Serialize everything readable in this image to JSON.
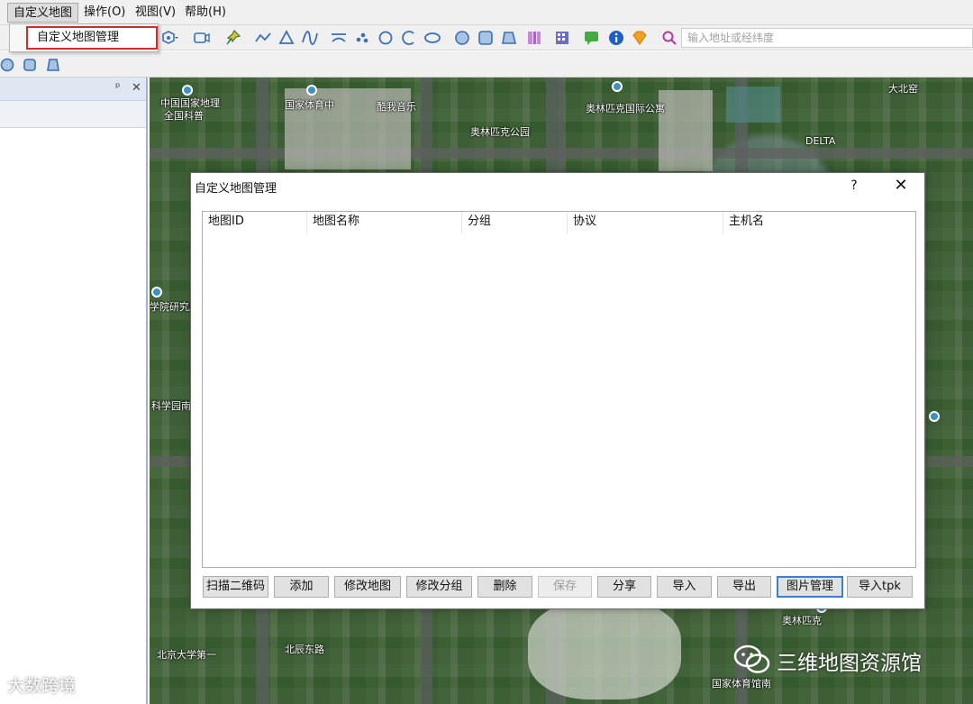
{
  "menubar": {
    "items": [
      {
        "label": "自定义地图"
      },
      {
        "label": "操作(O)"
      },
      {
        "label": "视图(V)"
      },
      {
        "label": "帮助(H)"
      }
    ]
  },
  "dropdown": {
    "item": "自定义地图管理"
  },
  "toolbar": {
    "search_placeholder": "输入地址或经纬度",
    "icons": [
      "hexagon-dropdown-icon",
      "camera-icon",
      "pin-icon",
      "polyline-icon",
      "triangle-icon",
      "curve-icon",
      "arc-icon",
      "points-icon",
      "circle-icon",
      "arc-circle-icon",
      "ellipse-icon",
      "polygon-icon",
      "square-icon",
      "trapezoid-icon",
      "book-icon",
      "building-icon",
      "chat-icon",
      "info-icon",
      "diamond-icon",
      "search-icon"
    ]
  },
  "left_panel": {
    "pin_glyph": "ᵖ",
    "close_glyph": "✕"
  },
  "map": {
    "labels": [
      {
        "text": "中国国家地理"
      },
      {
        "text": "全国科普"
      },
      {
        "text": "国家体育中"
      },
      {
        "text": "酷我音乐"
      },
      {
        "text": "奥林匹克公园"
      },
      {
        "text": "奥林匹克国际公寓"
      },
      {
        "text": "DELTA"
      },
      {
        "text": "大北窑"
      },
      {
        "text": "学院研究所"
      },
      {
        "text": "科学园南"
      },
      {
        "text": "北京大学第一"
      },
      {
        "text": "北辰东路"
      },
      {
        "text": "国家体育馆南"
      },
      {
        "text": "奥林匹克"
      }
    ]
  },
  "dialog": {
    "title": "自定义地图管理",
    "help": "?",
    "close": "✕",
    "columns": [
      "地图ID",
      "地图名称",
      "分组",
      "协议",
      "主机名"
    ],
    "buttons": [
      {
        "label": "扫描二维码",
        "enabled": true
      },
      {
        "label": "添加",
        "enabled": true
      },
      {
        "label": "修改地图",
        "enabled": true
      },
      {
        "label": "修改分组",
        "enabled": true
      },
      {
        "label": "删除",
        "enabled": true
      },
      {
        "label": "保存",
        "enabled": false
      },
      {
        "label": "分享",
        "enabled": true
      },
      {
        "label": "导入",
        "enabled": true
      },
      {
        "label": "导出",
        "enabled": true
      },
      {
        "label": "图片管理",
        "enabled": true
      },
      {
        "label": "导入tpk",
        "enabled": true
      }
    ]
  },
  "watermarks": {
    "left": "大数跨境",
    "right": "三维地图资源馆"
  },
  "colors": {
    "highlight_border": "#d42a2a",
    "focus_border": "#3c7fd1",
    "map_green": "#3f6a37"
  }
}
